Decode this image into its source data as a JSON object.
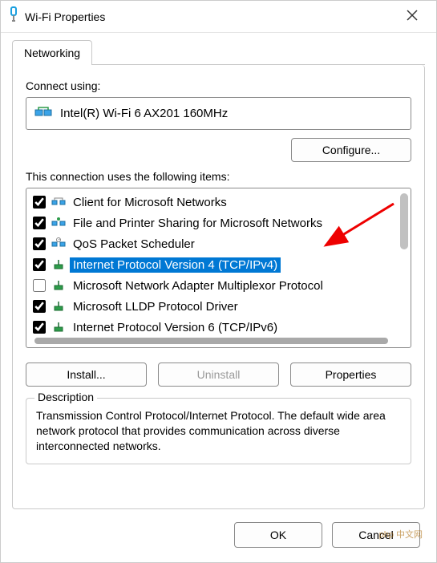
{
  "title": "Wi-Fi Properties",
  "tabs": {
    "networking": "Networking"
  },
  "connect_using_label": "Connect using:",
  "adapter": {
    "name": "Intel(R) Wi-Fi 6 AX201 160MHz"
  },
  "configure_label": "Configure...",
  "items_label": "This connection uses the following items:",
  "items": [
    {
      "checked": true,
      "label": "Client for Microsoft Networks",
      "selected": false,
      "icon": "client"
    },
    {
      "checked": true,
      "label": "File and Printer Sharing for Microsoft Networks",
      "selected": false,
      "icon": "share"
    },
    {
      "checked": true,
      "label": "QoS Packet Scheduler",
      "selected": false,
      "icon": "qos"
    },
    {
      "checked": true,
      "label": "Internet Protocol Version 4 (TCP/IPv4)",
      "selected": true,
      "icon": "proto"
    },
    {
      "checked": false,
      "label": "Microsoft Network Adapter Multiplexor Protocol",
      "selected": false,
      "icon": "proto"
    },
    {
      "checked": true,
      "label": "Microsoft LLDP Protocol Driver",
      "selected": false,
      "icon": "proto"
    },
    {
      "checked": true,
      "label": "Internet Protocol Version 6 (TCP/IPv6)",
      "selected": false,
      "icon": "proto"
    }
  ],
  "buttons": {
    "install": "Install...",
    "uninstall": "Uninstall",
    "properties": "Properties"
  },
  "description": {
    "legend": "Description",
    "text": "Transmission Control Protocol/Internet Protocol. The default wide area network protocol that provides communication across diverse interconnected networks."
  },
  "footer": {
    "ok": "OK",
    "cancel": "Cancel"
  },
  "watermark": "php 中文网"
}
